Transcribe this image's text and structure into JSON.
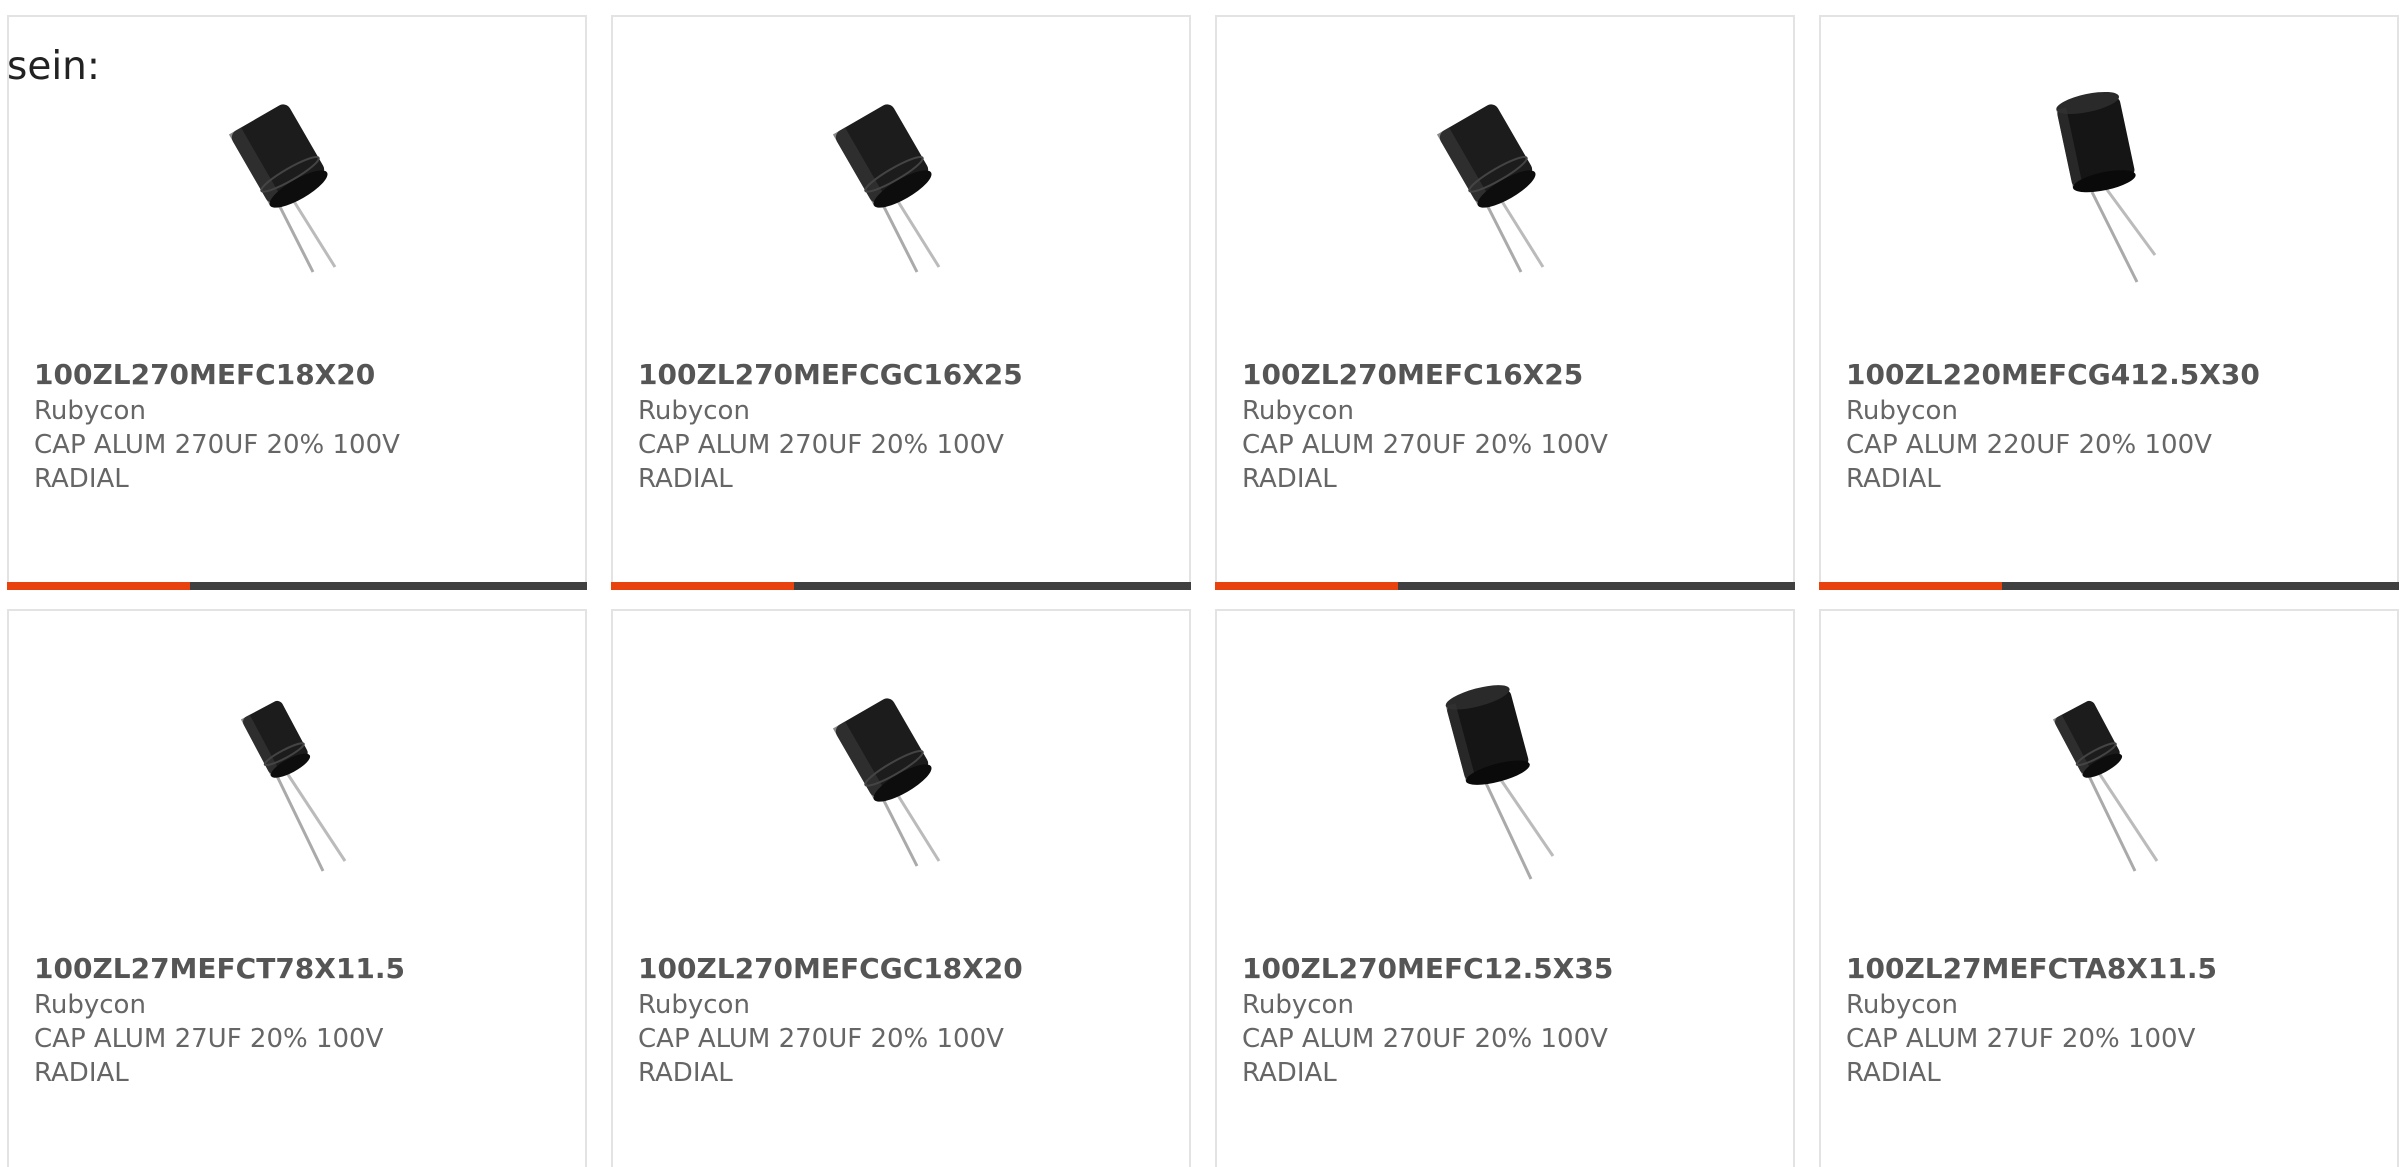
{
  "intro_text": "sein:",
  "colors": {
    "accent": "#e8420f",
    "bar": "#404040",
    "border": "#e3e3e3"
  },
  "products": [
    {
      "part": "100ZL270MEFC18X20",
      "manufacturer": "Rubycon",
      "description": "CAP ALUM 270UF 20% 100V RADIAL",
      "icon": "capacitor-tilted-icon"
    },
    {
      "part": "100ZL270MEFCGC16X25",
      "manufacturer": "Rubycon",
      "description": "CAP ALUM 270UF 20% 100V RADIAL",
      "icon": "capacitor-tilted-icon"
    },
    {
      "part": "100ZL270MEFC16X25",
      "manufacturer": "Rubycon",
      "description": "CAP ALUM 270UF 20% 100V RADIAL",
      "icon": "capacitor-tilted-icon"
    },
    {
      "part": "100ZL220MEFCG412.5X30",
      "manufacturer": "Rubycon",
      "description": "CAP ALUM 220UF 20% 100V RADIAL",
      "icon": "capacitor-upright-icon"
    },
    {
      "part": "100ZL27MEFCT78X11.5",
      "manufacturer": "Rubycon",
      "description": "CAP ALUM 27UF 20% 100V RADIAL",
      "icon": "capacitor-small-icon"
    },
    {
      "part": "100ZL270MEFCGC18X20",
      "manufacturer": "Rubycon",
      "description": "CAP ALUM 270UF 20% 100V RADIAL",
      "icon": "capacitor-tilted-icon"
    },
    {
      "part": "100ZL270MEFC12.5X35",
      "manufacturer": "Rubycon",
      "description": "CAP ALUM 270UF 20% 100V RADIAL",
      "icon": "capacitor-upright-icon"
    },
    {
      "part": "100ZL27MEFCTA8X11.5",
      "manufacturer": "Rubycon",
      "description": "CAP ALUM 27UF 20% 100V RADIAL",
      "icon": "capacitor-small-icon"
    }
  ]
}
